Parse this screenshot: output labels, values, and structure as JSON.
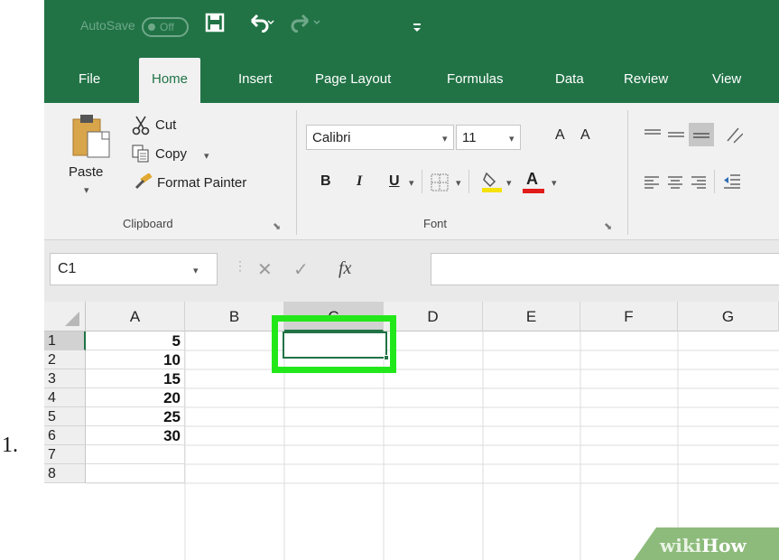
{
  "step_number": "1.",
  "colors": {
    "excel_green": "#217346",
    "highlight_green": "#22e81a",
    "watermark_green": "#8dbb7b"
  },
  "titlebar": {
    "autosave_label": "AutoSave",
    "autosave_state": "Off",
    "icons": [
      "save-icon",
      "undo-icon",
      "redo-icon",
      "customize-quick-access-icon"
    ]
  },
  "tabs": [
    {
      "label": "File"
    },
    {
      "label": "Home",
      "active": true
    },
    {
      "label": "Insert"
    },
    {
      "label": "Page Layout"
    },
    {
      "label": "Formulas"
    },
    {
      "label": "Data"
    },
    {
      "label": "Review"
    },
    {
      "label": "View"
    }
  ],
  "ribbon": {
    "clipboard": {
      "paste": "Paste",
      "cut": "Cut",
      "copy": "Copy",
      "format_painter": "Format Painter",
      "group_label": "Clipboard"
    },
    "font": {
      "font_name": "Calibri",
      "font_size": "11",
      "bold": "B",
      "italic": "I",
      "underline": "U",
      "font_color_letter": "A",
      "grow_font": "A",
      "shrink_font": "A",
      "group_label": "Font"
    }
  },
  "formula_bar": {
    "name_box": "C1",
    "cancel": "✕",
    "enter": "✓",
    "fx": "fx",
    "value": ""
  },
  "grid": {
    "columns": [
      "A",
      "B",
      "C",
      "D",
      "E",
      "F",
      "G"
    ],
    "selected_column": "C",
    "rows": [
      {
        "num": "1",
        "a": "5"
      },
      {
        "num": "2",
        "a": "10"
      },
      {
        "num": "3",
        "a": "15"
      },
      {
        "num": "4",
        "a": "20"
      },
      {
        "num": "5",
        "a": "25"
      },
      {
        "num": "6",
        "a": "30"
      },
      {
        "num": "7",
        "a": ""
      },
      {
        "num": "8",
        "a": ""
      }
    ],
    "active_cell": "C1"
  },
  "watermark": {
    "wiki": "wiki",
    "how": "How"
  }
}
